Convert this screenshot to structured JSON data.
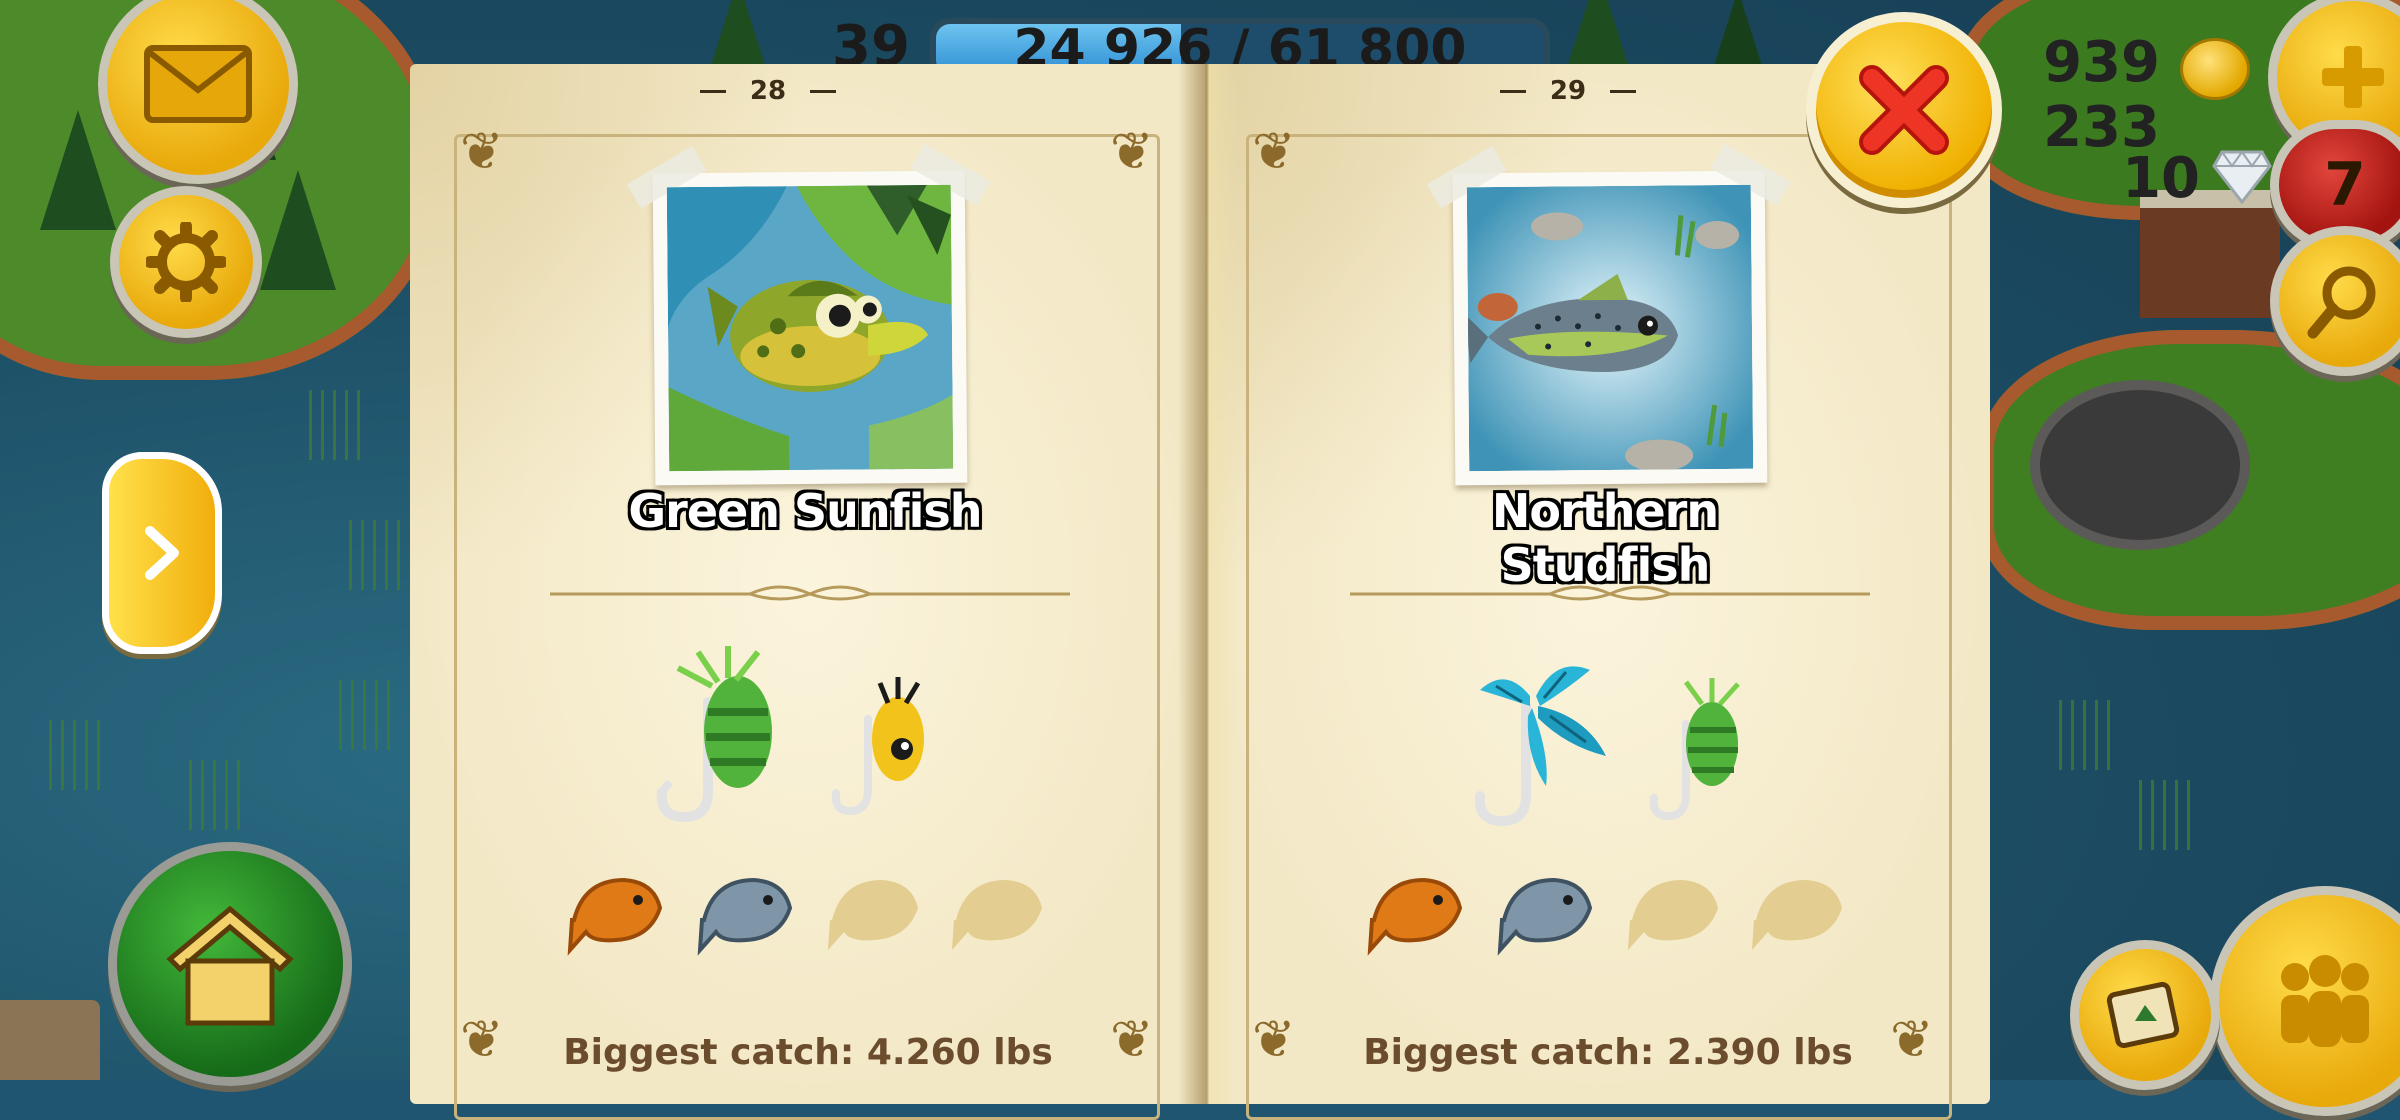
{
  "hud": {
    "level": "39",
    "xp_text": "24 926 / 61 800",
    "xp_progress": 0.403,
    "coins": "939 233",
    "diamonds": "10",
    "notification_count": "7"
  },
  "book": {
    "left_page": {
      "page_number": "28",
      "fish_name": "Green Sunfish",
      "biggest_catch": "Biggest catch: 4.260 lbs",
      "lures": [
        "green-feather-lure-icon",
        "yellow-spinner-lure-icon"
      ],
      "trophies": [
        {
          "name": "gold-fish-trophy-icon",
          "achieved": true
        },
        {
          "name": "silver-fish-trophy-icon",
          "achieved": true
        },
        {
          "name": "fish-trophy-placeholder-icon",
          "achieved": false
        },
        {
          "name": "fish-trophy-placeholder-icon",
          "achieved": false
        }
      ]
    },
    "right_page": {
      "page_number": "29",
      "fish_name": "Northern Studfish",
      "biggest_catch": "Biggest catch: 2.390 lbs",
      "lures": [
        "blue-feather-lure-icon",
        "green-feather-lure-icon"
      ],
      "trophies": [
        {
          "name": "gold-fish-trophy-icon",
          "achieved": true
        },
        {
          "name": "silver-fish-trophy-icon",
          "achieved": true
        },
        {
          "name": "fish-trophy-placeholder-icon",
          "achieved": false
        },
        {
          "name": "fish-trophy-placeholder-icon",
          "achieved": false
        }
      ]
    }
  },
  "colors": {
    "book_paper": "#f3e8c6",
    "catch_text": "#6b4d2e",
    "button_yellow": "#f0b000",
    "close_x": "#e2261b"
  }
}
